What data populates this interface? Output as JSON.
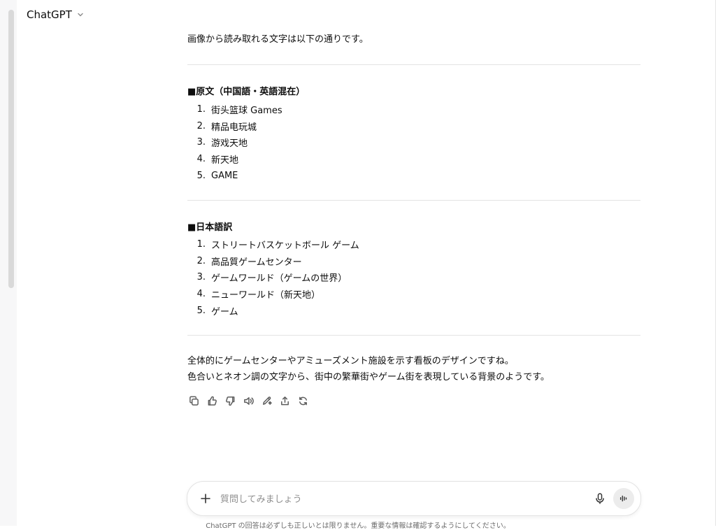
{
  "header": {
    "model_name": "ChatGPT"
  },
  "message": {
    "intro": "画像から読み取れる文字は以下の通りです。",
    "sections": [
      {
        "heading": "■原文（中国語・英語混在）",
        "items": [
          "街头篮球 Games",
          "精品电玩城",
          "游戏天地",
          "新天地",
          "GAME"
        ]
      },
      {
        "heading": "■日本語訳",
        "items": [
          "ストリートバスケットボール ゲーム",
          "高品質ゲームセンター",
          "ゲームワールド（ゲームの世界）",
          "ニューワールド（新天地）",
          "ゲーム"
        ]
      }
    ],
    "summary_line1": "全体的にゲームセンターやアミューズメント施設を示す看板のデザインですね。",
    "summary_line2": "色合いとネオン調の文字から、街中の繁華街やゲーム街を表現している背景のようです。",
    "actions": [
      "copy-icon",
      "thumbs-up-icon",
      "thumbs-down-icon",
      "read-aloud-icon",
      "edit-icon",
      "share-icon",
      "regenerate-icon"
    ]
  },
  "composer": {
    "placeholder": "質問してみましょう"
  },
  "footer": {
    "disclaimer": "ChatGPT の回答は必ずしも正しいとは限りません。重要な情報は確認するようにしてください。"
  }
}
